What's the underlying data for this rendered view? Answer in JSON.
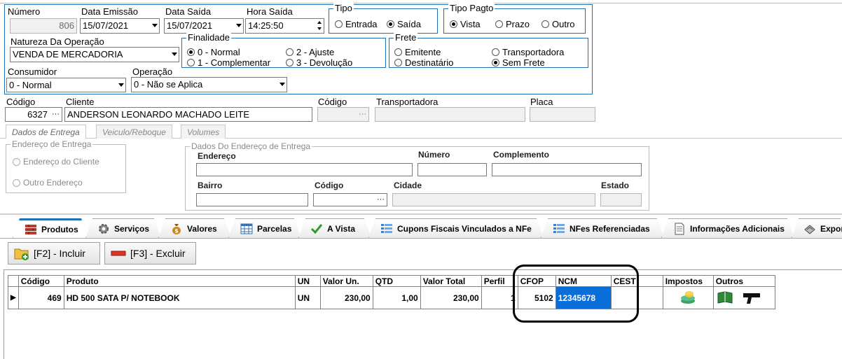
{
  "header": {
    "numero_label": "Número",
    "numero_value": "806",
    "data_emissao_label": "Data Emissão",
    "data_emissao_value": "15/07/2021",
    "data_saida_label": "Data Saída",
    "data_saida_value": "15/07/2021",
    "hora_saida_label": "Hora Saída",
    "hora_saida_value": "14:25:50",
    "tipo_title": "Tipo",
    "tipo_options": [
      "Entrada",
      "Saída"
    ],
    "tipo_pagto_title": "Tipo Pagto",
    "tipo_pagto_options": [
      "Vista",
      "Prazo",
      "Outro"
    ],
    "natureza_label": "Natureza Da Operação",
    "natureza_value": "VENDA DE MERCADORIA",
    "finalidade_title": "Finalidade",
    "finalidade_options": [
      "0 - Normal",
      "2 - Ajuste",
      "1 - Complementar",
      "3 - Devolução"
    ],
    "frete_title": "Frete",
    "frete_options": [
      "Emitente",
      "Transportadora",
      "Destinatário",
      "Sem Frete"
    ],
    "consumidor_label": "Consumidor",
    "consumidor_value": "0 - Normal",
    "operacao_label": "Operação",
    "operacao_value": "0 - Não se Aplica"
  },
  "cliente": {
    "codigo_label": "Código",
    "codigo_value": "6327",
    "cliente_label": "Cliente",
    "cliente_value": "ANDERSON LEONARDO MACHADO LEITE",
    "codigo2_label": "Código",
    "transportadora_label": "Transportadora",
    "placa_label": "Placa",
    "ellipsis": "···"
  },
  "entrega_tabs": [
    "Dados de Entrega",
    "Veiculo/Reboque",
    "Volumes"
  ],
  "entrega": {
    "endereco_group_title": "Endereço de Entrega",
    "endereco_options": [
      "Endereço do Cliente",
      "Outro Endereço"
    ],
    "dados_group_title": "Dados Do Endereço de Entrega",
    "endereco_label": "Endereço",
    "numero_label": "Número",
    "complemento_label": "Complemento",
    "bairro_label": "Bairro",
    "codigo_label": "Código",
    "cidade_label": "Cidade",
    "estado_label": "Estado"
  },
  "main_tabs": [
    "Produtos",
    "Serviços",
    "Valores",
    "Parcelas",
    "A Vista",
    "Cupons Fiscais Vinculados a NFe",
    "NFes Referenciadas",
    "Informações Adicionais",
    "Expor"
  ],
  "toolbar": {
    "incluir_label": "[F2] - Incluir",
    "excluir_label": "[F3] - Excluir"
  },
  "grid": {
    "columns": [
      "Código",
      "Produto",
      "UN",
      "Valor Un.",
      "QTD",
      "Valor Total",
      "Perfil",
      "CFOP",
      "NCM",
      "CEST",
      "Impostos",
      "Outros"
    ],
    "rows": [
      {
        "codigo": "469",
        "produto": "HD 500 SATA P/ NOTEBOOK",
        "un": "UN",
        "valor_un": "230,00",
        "qtd": "1,00",
        "valor_total": "230,00",
        "perfil": "1",
        "cfop": "5102",
        "ncm": "12345678",
        "cest": ""
      }
    ]
  },
  "colors": {
    "group_border": "#1f6fb5",
    "selection": "#0a6ed8",
    "annotation": "#000000"
  }
}
